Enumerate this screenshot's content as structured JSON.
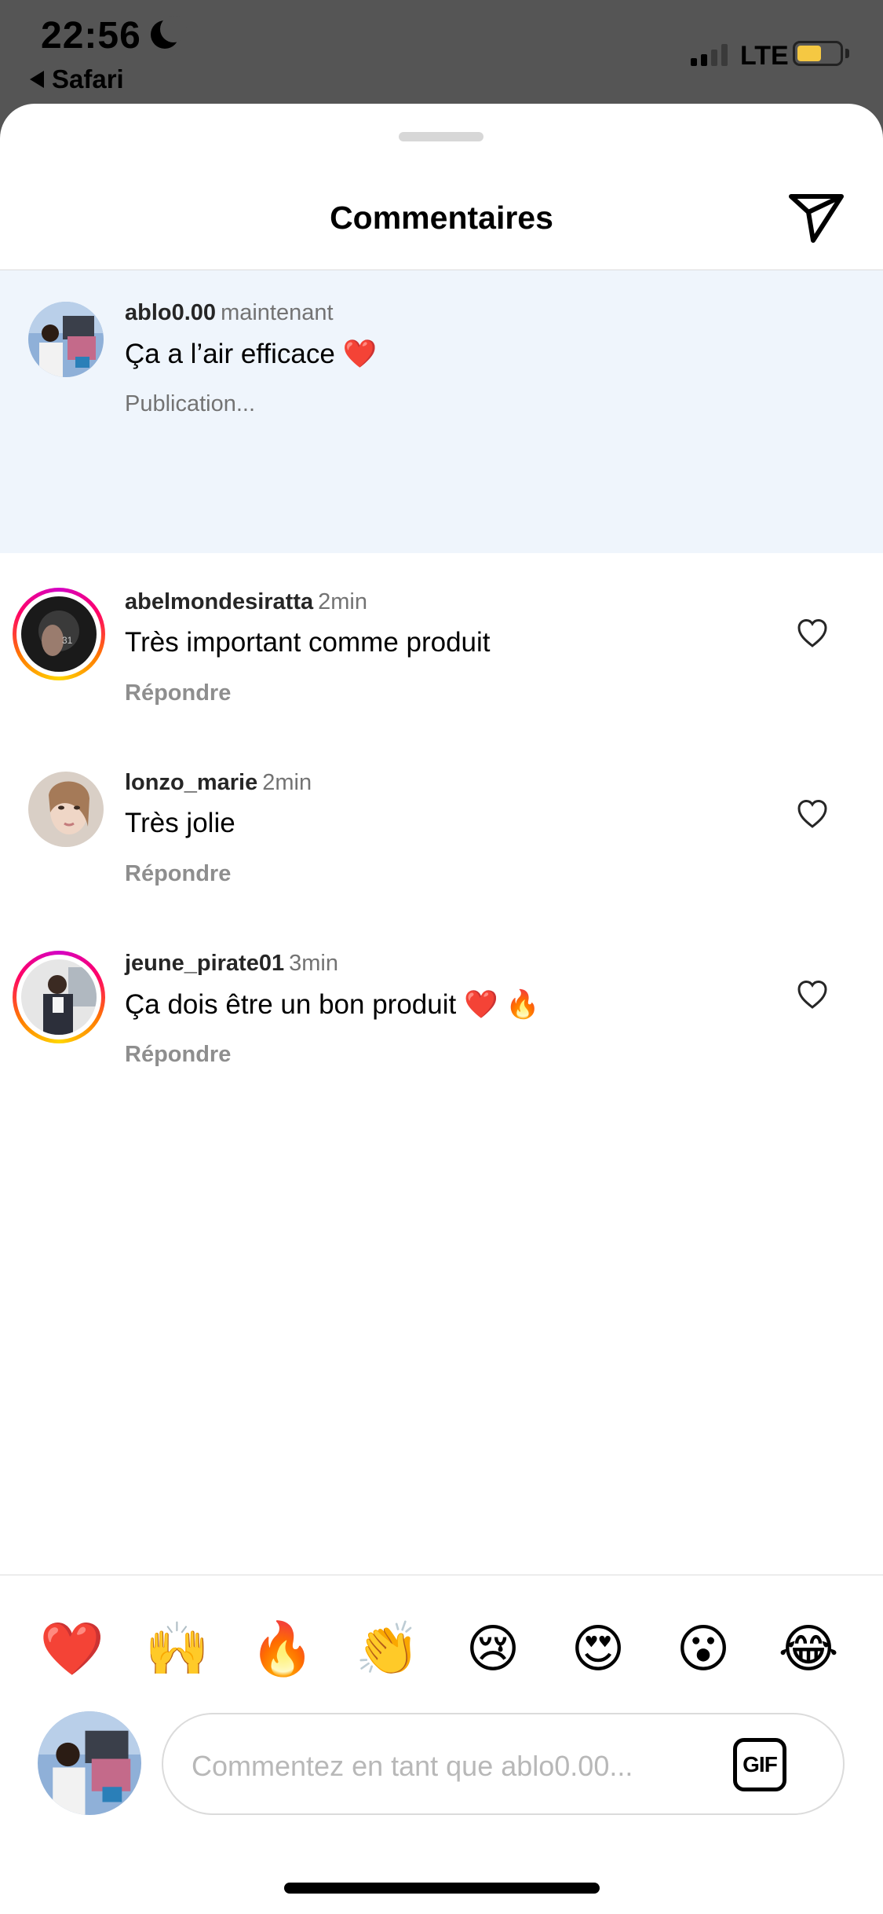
{
  "status_bar": {
    "time": "22:56",
    "back_app": "Safari",
    "network": "LTE",
    "battery_level": 0.58
  },
  "header": {
    "title": "Commentaires"
  },
  "comments": [
    {
      "username": "ablo0.00",
      "time": "maintenant",
      "text": "Ça a l’air efficace ❤️",
      "status": "Publication...",
      "pending": true
    },
    {
      "username": "abelmondesiratta",
      "time": "2min",
      "text": "Très important comme produit",
      "reply": "Répondre",
      "story_ring": true
    },
    {
      "username": "lonzo_marie",
      "time": "2min",
      "text": "Très jolie",
      "reply": "Répondre",
      "story_ring": false
    },
    {
      "username": "jeune_pirate01",
      "time": "3min",
      "text": "Ça dois être un bon produit ❤️ 🔥",
      "reply": "Répondre",
      "story_ring": true
    }
  ],
  "quick_reactions": [
    "❤️",
    "🙌",
    "🔥",
    "👏",
    "😢",
    "😍",
    "😮",
    "😂"
  ],
  "composer": {
    "placeholder": "Commentez en tant que ablo0.00...",
    "gif_label": "GIF"
  },
  "icons": {
    "send": "paper-plane-icon",
    "like": "heart-outline-icon",
    "signal": "cellular-signal-icon",
    "battery": "battery-icon",
    "moon": "moon-icon"
  },
  "colors": {
    "pending_bg": "#eff5fc",
    "battery_fill": "#f5c842",
    "secondary_text": "#737373"
  }
}
